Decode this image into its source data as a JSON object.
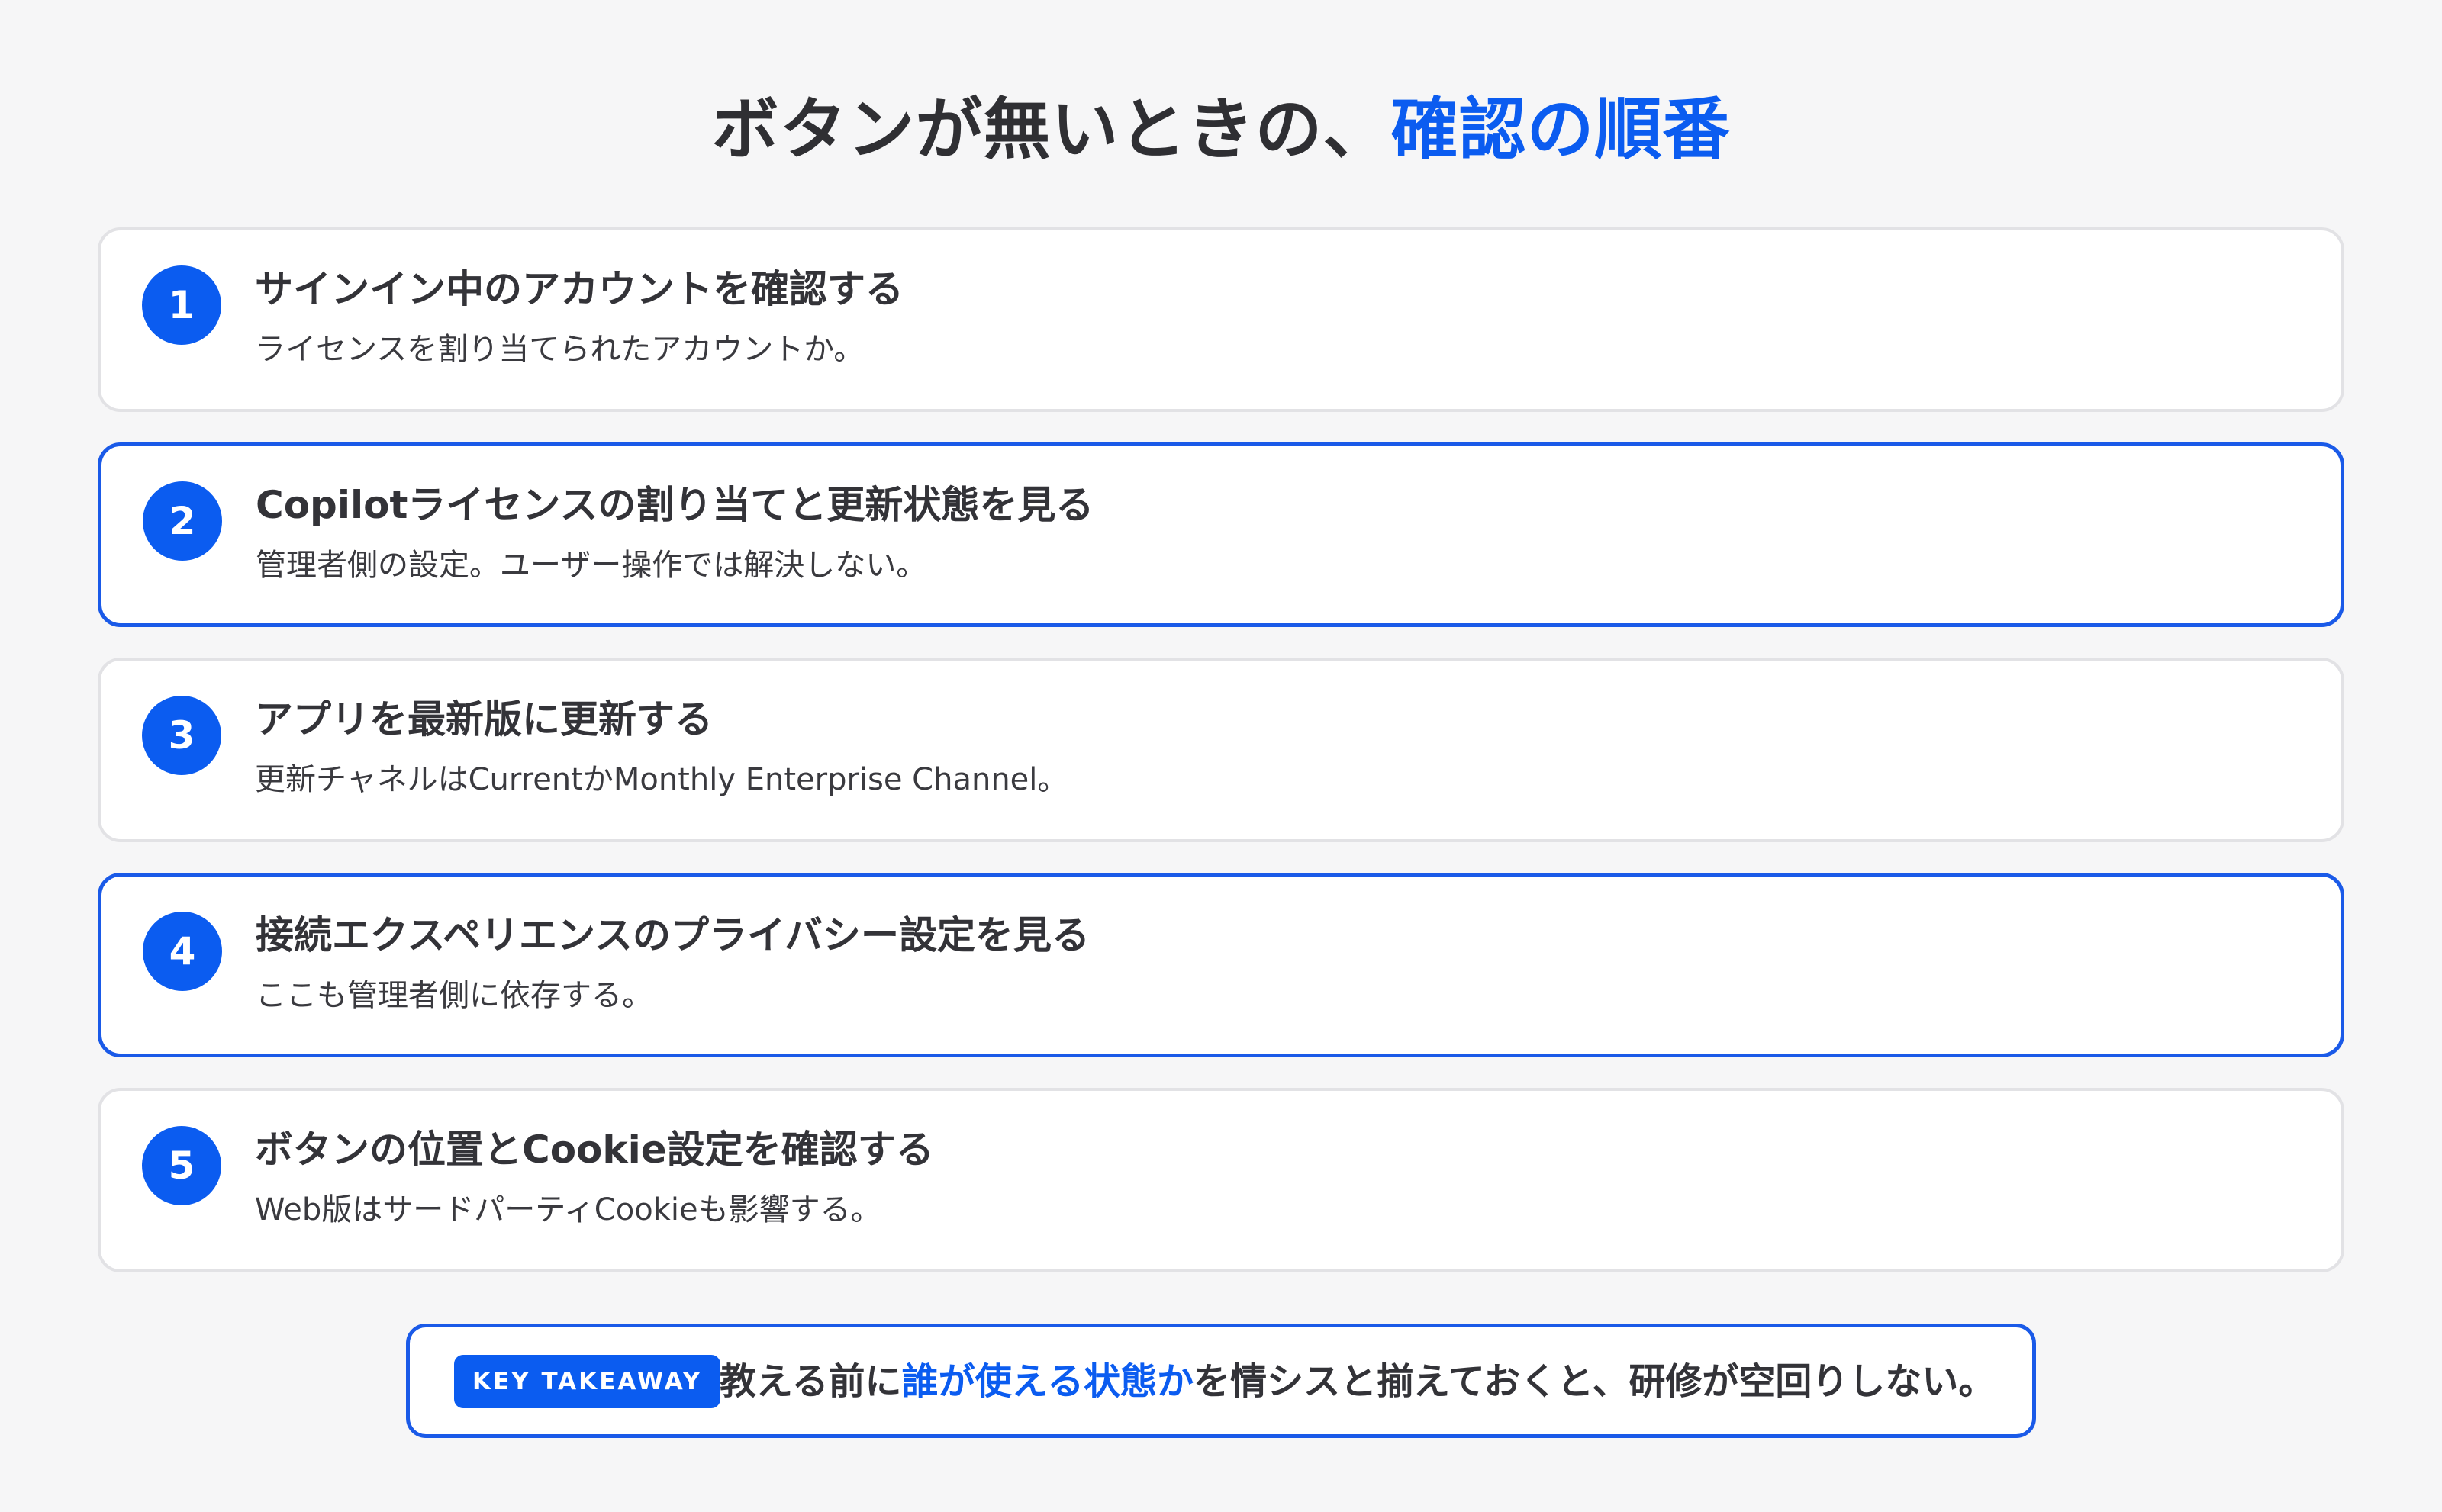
{
  "colors": {
    "accent": "#0b5cf0",
    "text": "#333338",
    "background": "#f6f6f7",
    "card": "#ffffff",
    "card_border": "#e2e2e5",
    "highlight_border": "#1a5ae8"
  },
  "header": {
    "title_main": "ボタンが無いときの、",
    "title_accent": "確認の順番"
  },
  "steps": [
    {
      "number": "1",
      "title": "サインイン中のアカウントを確認する",
      "description": "ライセンスを割り当てられたアカウントか。"
    },
    {
      "number": "2",
      "title": "Copilotライセンスの割り当てと更新状態を見る",
      "description": "管理者側の設定。ユーザー操作では解決しない。"
    },
    {
      "number": "3",
      "title": "アプリを最新版に更新する",
      "description": "更新チャネルはCurrentかMonthly Enterprise Channel。"
    },
    {
      "number": "4",
      "title": "接続エクスペリエンスのプライバシー設定を見る",
      "description": "ここも管理者側に依存する。"
    },
    {
      "number": "5",
      "title": "ボタンの位置とCookie設定を確認する",
      "description": "Web版はサードパーティCookieも影響する。"
    }
  ],
  "takeaway": {
    "badge": "KEY TAKEAWAY",
    "text_before": "教える前に",
    "text_accent": "誰が使える状態か",
    "text_after": "を情シスと揃えておくと、研修が空回りしない。"
  }
}
